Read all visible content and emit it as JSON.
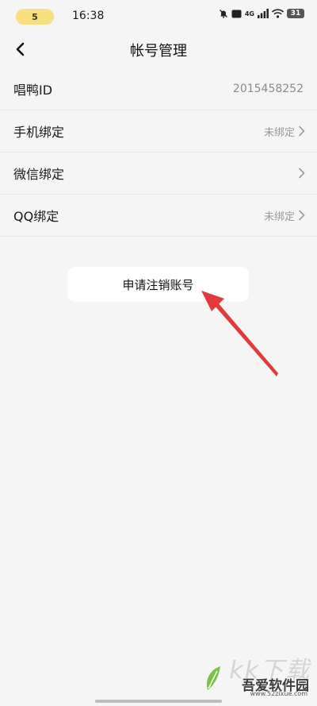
{
  "status_bar": {
    "pill_text": "5",
    "time": "16:38",
    "network": "4G",
    "hd": "HD",
    "battery": "31"
  },
  "nav": {
    "back_icon": "chevron-left-icon",
    "title": "帐号管理"
  },
  "rows": [
    {
      "label": "唱鸭ID",
      "value": "2015458252"
    },
    {
      "label": "手机绑定",
      "status": "未绑定"
    },
    {
      "label": "微信绑定",
      "status": ""
    },
    {
      "label": "QQ绑定",
      "status": "未绑定"
    }
  ],
  "cancel_account_label": "申请注销账号",
  "annotation_color": "#e23a3a",
  "watermark": {
    "big": "kk下载",
    "title": "吾爱软件园",
    "url": "www.52zixue.com"
  }
}
